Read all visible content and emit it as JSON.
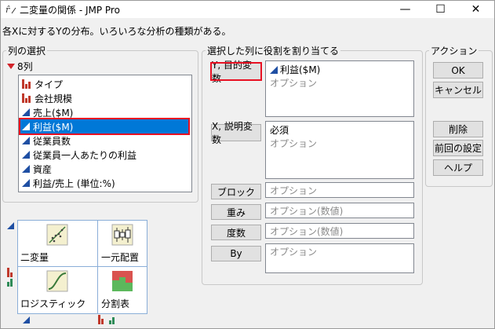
{
  "window": {
    "title": "二変量の関係 - JMP Pro",
    "minimize": "—",
    "maximize": "☐",
    "close": "✕"
  },
  "description": "各Xに対するYの分布。いろいろな分析の種類がある。",
  "column_select": {
    "legend": "列の選択",
    "count": "8列",
    "items": [
      {
        "label": "タイプ",
        "icon": "nominal-bar-icon"
      },
      {
        "label": "会社規模",
        "icon": "nominal-bar-icon"
      },
      {
        "label": "売上($M)",
        "icon": "continuous-triangle-icon"
      },
      {
        "label": "利益($M)",
        "icon": "continuous-triangle-icon"
      },
      {
        "label": "従業員数",
        "icon": "continuous-triangle-icon"
      },
      {
        "label": "従業員一人あたりの利益",
        "icon": "continuous-triangle-icon"
      },
      {
        "label": "資産",
        "icon": "continuous-triangle-icon"
      },
      {
        "label": "利益/売上 (単位:%)",
        "icon": "continuous-triangle-icon"
      }
    ],
    "selected_index": 3
  },
  "roles": {
    "legend": "選択した列に役割を割り当てる",
    "y_button": "Y, 目的変数",
    "y_value": "利益($M)",
    "y_optional": "オプション",
    "x_button": "X, 説明変数",
    "x_required": "必須",
    "x_optional": "オプション",
    "block_button": "ブロック",
    "block_value": "オプション",
    "weight_button": "重み",
    "weight_value": "オプション(数値)",
    "freq_button": "度数",
    "freq_value": "オプション(数値)",
    "by_button": "By",
    "by_value": "オプション"
  },
  "actions": {
    "legend": "アクション",
    "ok": "OK",
    "cancel": "キャンセル",
    "remove": "削除",
    "recall": "前回の設定",
    "help": "ヘルプ"
  },
  "platforms": [
    {
      "label": "二変量",
      "icon": "scatterplot-icon"
    },
    {
      "label": "一元配置",
      "icon": "oneway-icon"
    },
    {
      "label": "ロジスティック",
      "icon": "logistic-curve-icon"
    },
    {
      "label": "分割表",
      "icon": "mosaic-icon"
    }
  ]
}
